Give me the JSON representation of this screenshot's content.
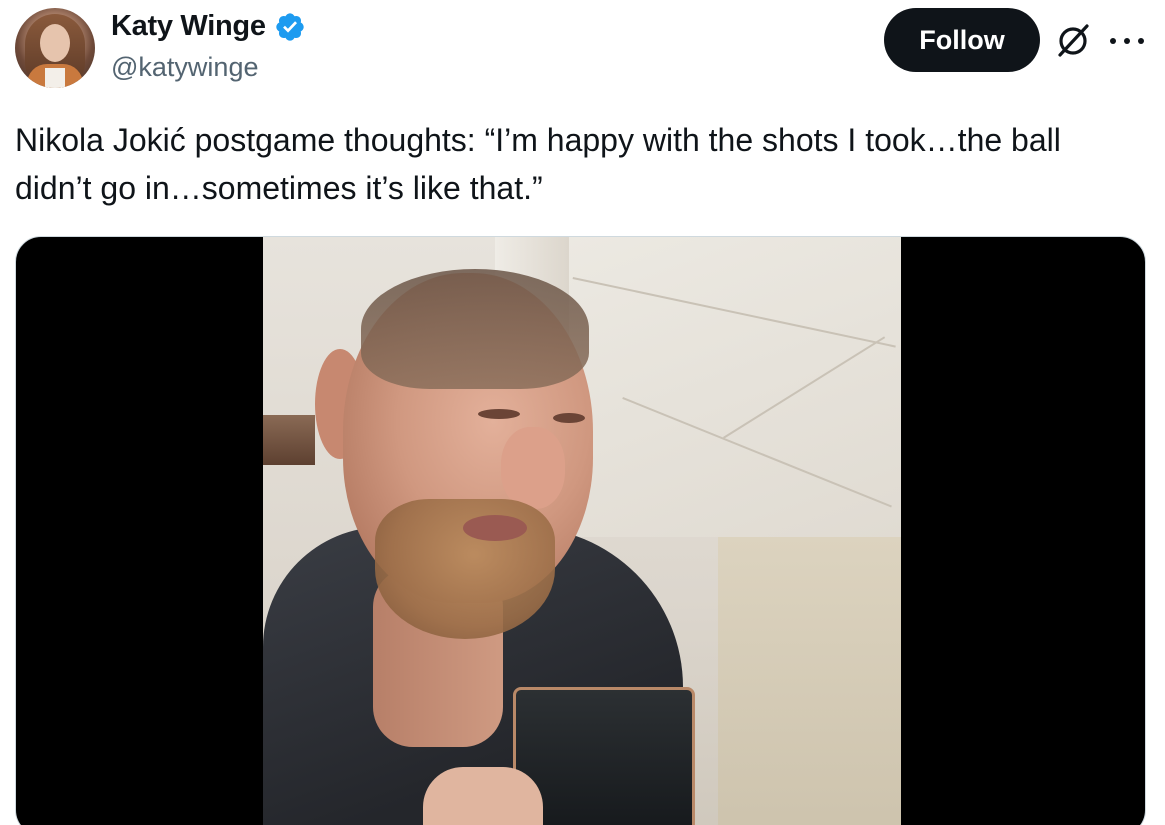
{
  "author": {
    "display_name": "Katy Winge",
    "handle": "@katywinge",
    "verified": true,
    "verified_color": "#1d9bf0"
  },
  "actions": {
    "follow_label": "Follow",
    "grok_icon": "grok-icon",
    "more_icon": "more-icon"
  },
  "tweet": {
    "text": "Nikola Jokić postgame thoughts: “I’m happy with the shots I took…the ball didn’t go in…sometimes it’s like that.”"
  },
  "media": {
    "type": "video"
  },
  "colors": {
    "text_primary": "#0f1419",
    "text_secondary": "#536471",
    "follow_bg": "#0f1419",
    "follow_text": "#ffffff"
  }
}
